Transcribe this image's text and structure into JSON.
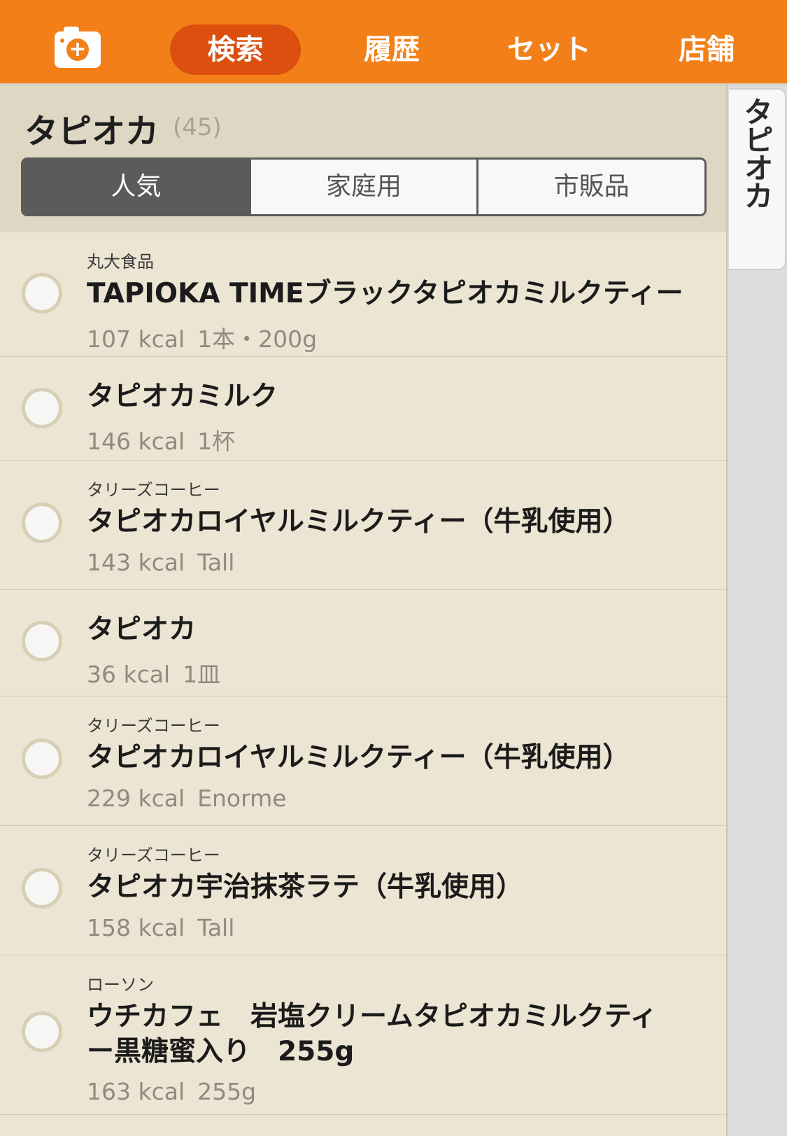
{
  "nav": {
    "camera_icon": "camera-plus-icon",
    "tabs": [
      {
        "label": "検索",
        "active": true
      },
      {
        "label": "履歴",
        "active": false
      },
      {
        "label": "セット",
        "active": false
      },
      {
        "label": "店舗",
        "active": false
      }
    ]
  },
  "header": {
    "title": "タピオカ",
    "count": "(45)",
    "segments": [
      {
        "label": "人気",
        "active": true
      },
      {
        "label": "家庭用",
        "active": false
      },
      {
        "label": "市販品",
        "active": false
      }
    ]
  },
  "side_index": {
    "label": "タピオカ"
  },
  "items": [
    {
      "maker": "丸大食品",
      "name": "TAPIOKA TIMEブラックタピオカミルクティー",
      "kcal": "107 kcal",
      "unit": "1本・200g"
    },
    {
      "maker": "",
      "name": "タピオカミルク",
      "kcal": "146 kcal",
      "unit": "1杯"
    },
    {
      "maker": "タリーズコーヒー",
      "name": "タピオカロイヤルミルクティー（牛乳使用）",
      "kcal": "143 kcal",
      "unit": "Tall"
    },
    {
      "maker": "",
      "name": "タピオカ",
      "kcal": "36 kcal",
      "unit": "1皿"
    },
    {
      "maker": "タリーズコーヒー",
      "name": "タピオカロイヤルミルクティー（牛乳使用）",
      "kcal": "229 kcal",
      "unit": "Enorme"
    },
    {
      "maker": "タリーズコーヒー",
      "name": "タピオカ宇治抹茶ラテ（牛乳使用）",
      "kcal": "158 kcal",
      "unit": "Tall"
    },
    {
      "maker": "ローソン",
      "name": "ウチカフェ　岩塩クリームタピオカミルクティー黒糖蜜入り　255g",
      "kcal": "163 kcal",
      "unit": "255g"
    }
  ],
  "colors": {
    "brand": "#f27f17",
    "active_tab": "#dc4f0e",
    "panel": "#ece5d3"
  }
}
